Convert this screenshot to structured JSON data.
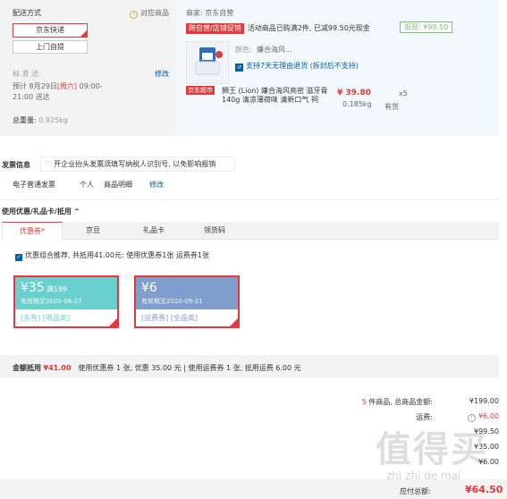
{
  "shipping": {
    "title": "配送方式",
    "supported_link": "对应商品",
    "option_jd": "京东快递",
    "option_self": "上门自提",
    "standard_label": "标  准  达:",
    "modify": "修改",
    "eta_prefix": "预计 8月29日",
    "eta_day": "[周六]",
    "eta_time1": "09:00-",
    "eta_time2": "21:00 送达",
    "weight_label": "总重量:",
    "weight_value": "0.925kg"
  },
  "order": {
    "seller": "商家: 京东自营",
    "promo_tag": "跨自营/店铺促销",
    "promo_text": "活动商品已购满2件, 已减99.50元现金",
    "go_shop": "逛现: ¥99.50",
    "color_label": "颜色:",
    "color_value": "嫌合海风...",
    "return_text": "支持7天无理由退货 (拆封后不支持)",
    "jd_tag": "京东超市",
    "product_name": "狮王 (Lion) 嫌合海风亮密 滋牙膏140g 清凉薄荷味 清新口气 祠",
    "price": "¥ 39.80",
    "qty": "x5",
    "weight": "0.185kg",
    "stock": "有货"
  },
  "invoice": {
    "title": "发票信息",
    "tip": "开企业抬头发票须填写纳税人识别号, 以免影响报销",
    "type": "电子普通发票",
    "person": "个人",
    "detail": "商品明细",
    "modify": "修改"
  },
  "coupons": {
    "section_title": "使用优惠/礼品卡/抵用 ^",
    "tabs": [
      "优惠券*",
      "京豆",
      "礼品卡",
      "领货码"
    ],
    "recommend": "优惠组合推荐, 共抵用41.00元: 使用优惠券1张 运费券1张",
    "cards": [
      {
        "amount": "¥35",
        "cond": "满199",
        "expiry": "有效期至2020-08-27",
        "tags": "[东券] [限品类]"
      },
      {
        "amount": "¥6",
        "cond": "",
        "expiry": "有效期至2020-09-21",
        "tags": "[运费券] [全品类]"
      }
    ],
    "deduct_label": "金额抵用",
    "deduct_value": "¥41.00",
    "deduct_detail": "使用优惠券 1 张, 优惠 35.00 元 | 使用运费券 1 张, 抵用运费 6.00 元"
  },
  "summary": {
    "count_prefix": "5",
    "goods_label": "件商品, 总商品金额:",
    "goods_value": "¥199.00",
    "freight_label": "运费:",
    "freight_value": "¥6.00",
    "row3_label": "...",
    "row3_value": "¥99.50",
    "row4_label": "...",
    "row4_value": "¥35.00",
    "row5_label": "...",
    "row5_value": "¥6.00",
    "total_label": "应付总额:",
    "total_value": "¥64.50"
  },
  "watermark": {
    "big": "值得买",
    "small": "zhi  zhi  de  mai"
  }
}
